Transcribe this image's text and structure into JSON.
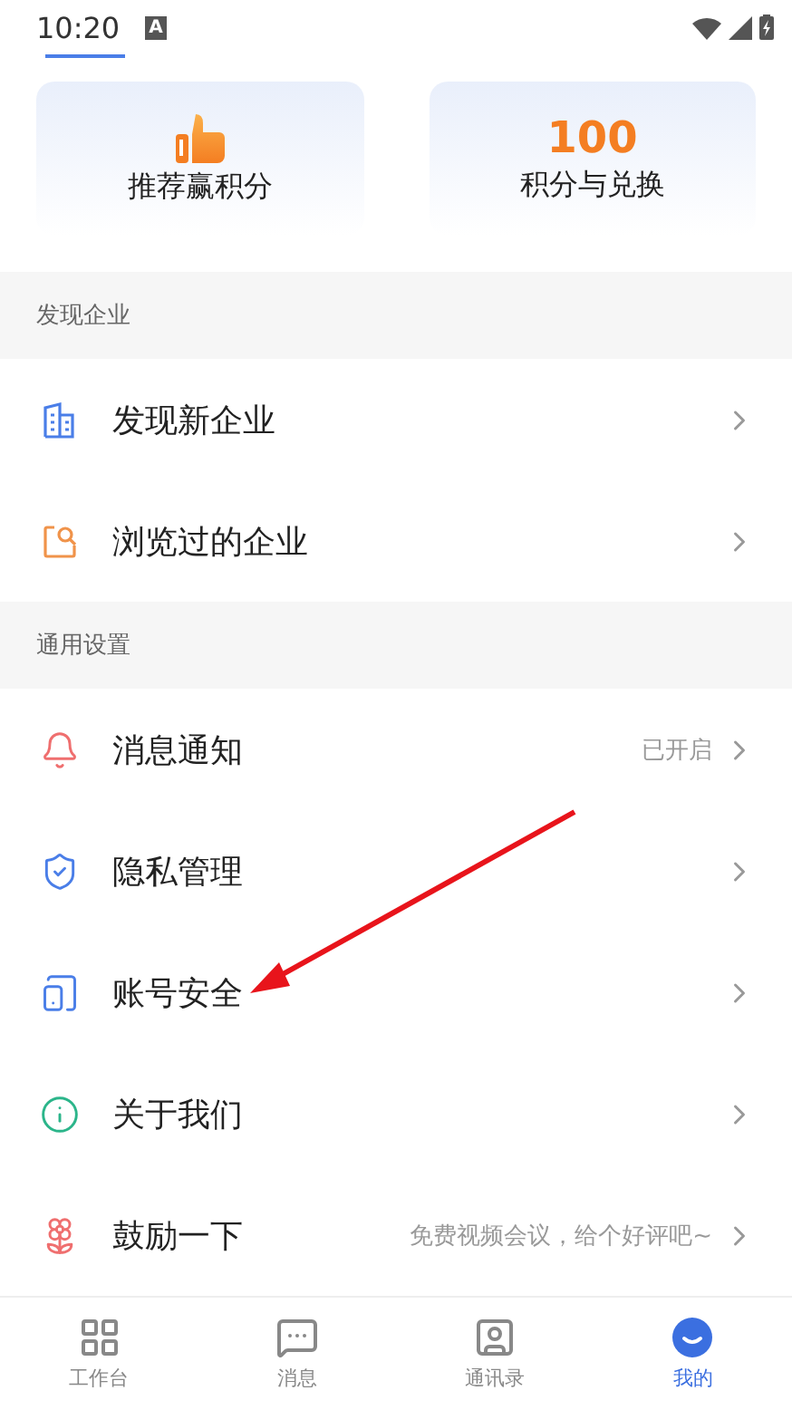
{
  "status_bar": {
    "time": "10:20",
    "input_indicator": "A"
  },
  "cards": [
    {
      "kind": "thumb",
      "label": "推荐赢积分"
    },
    {
      "kind": "number",
      "value": "100",
      "label": "积分与兑换"
    }
  ],
  "sections": [
    {
      "title": "发现企业",
      "items": [
        {
          "kind": "building",
          "label": "发现新企业"
        },
        {
          "kind": "browsed",
          "label": "浏览过的企业"
        }
      ]
    },
    {
      "title": "通用设置",
      "items": [
        {
          "kind": "bell",
          "label": "消息通知",
          "value": "已开启"
        },
        {
          "kind": "shield",
          "label": "隐私管理"
        },
        {
          "kind": "phone",
          "label": "账号安全"
        },
        {
          "kind": "info",
          "label": "关于我们"
        },
        {
          "kind": "flower",
          "label": "鼓励一下",
          "value": "免费视频会议，给个好评吧~"
        }
      ]
    }
  ],
  "tabs": [
    {
      "kind": "grid",
      "label": "工作台",
      "selected": false
    },
    {
      "kind": "message",
      "label": "消息",
      "selected": false
    },
    {
      "kind": "contacts",
      "label": "通讯录",
      "selected": false
    },
    {
      "kind": "me",
      "label": "我的",
      "selected": true
    }
  ]
}
